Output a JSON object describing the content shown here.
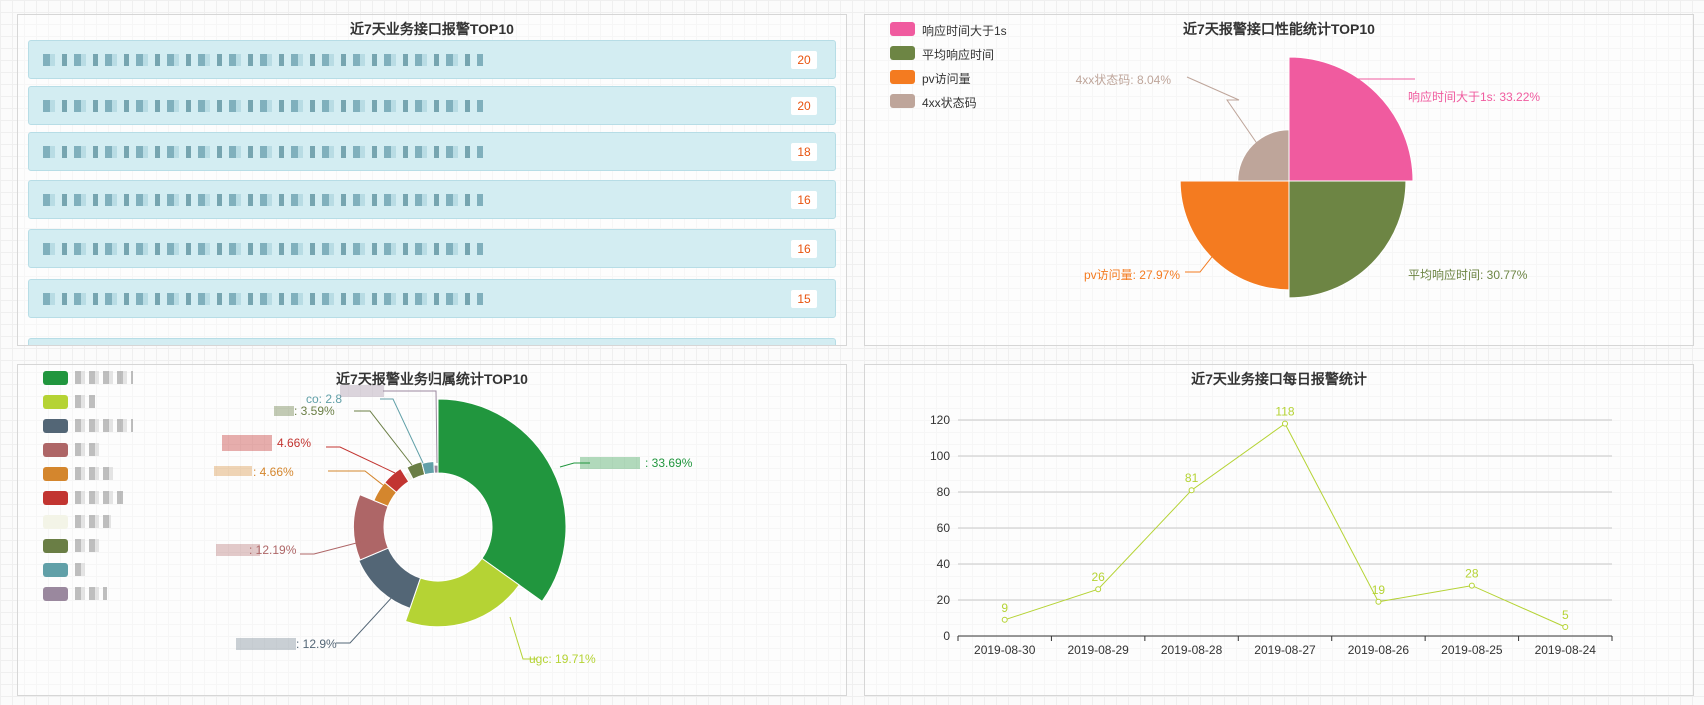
{
  "colors": {
    "pink": "#f05b9f",
    "olive": "#6d8544",
    "orange": "#f47b20",
    "taupe": "#bea59a",
    "green": "#21963e",
    "lime": "#b5d334",
    "slate": "#536676",
    "rose": "#ae6667",
    "amber": "#d4862d",
    "red": "#c23531",
    "ivory": "#f3f4e7",
    "moss": "#6a7e45",
    "teal": "#61a0a8",
    "mauve": "#9a889e",
    "accent_count": "#e8530e",
    "row_bg": "#d3edf2"
  },
  "panel_top10": {
    "title": "近7天业务接口报警TOP10",
    "rows": [
      {
        "count": "20"
      },
      {
        "count": "20"
      },
      {
        "count": "18"
      },
      {
        "count": "16"
      },
      {
        "count": "16"
      },
      {
        "count": "15"
      },
      {
        "count": ""
      }
    ]
  },
  "panel_perf": {
    "title": "近7天报警接口性能统计TOP10",
    "legend": [
      "响应时间大于1s",
      "平均响应时间",
      "pv访问量",
      "4xx状态码"
    ],
    "labels": [
      "响应时间大于1s: 33.22%",
      "平均响应时间: 30.77%",
      "pv访问量: 27.97%",
      "4xx状态码: 8.04%"
    ]
  },
  "panel_owner": {
    "title": "近7天报警业务归属统计TOP10",
    "labels": [
      ": 33.69%",
      "ugc: 19.71%",
      ": 12.9%",
      ": 12.19%",
      ": 4.66%",
      "4.66%",
      ": 3.59%",
      "co: 2.8"
    ]
  },
  "panel_daily": {
    "title": "近7天业务接口每日报警统计"
  },
  "chart_data": [
    {
      "type": "pie",
      "title": "近7天报警接口性能统计TOP10",
      "rose": true,
      "categories": [
        "响应时间大于1s",
        "平均响应时间",
        "pv访问量",
        "4xx状态码"
      ],
      "values": [
        33.22,
        30.77,
        27.97,
        8.04
      ],
      "unit": "%",
      "legend": "top-left"
    },
    {
      "type": "pie",
      "title": "近7天报警业务归属统计TOP10",
      "donut": true,
      "categories": [
        "",
        "ugc",
        "",
        "",
        "",
        "",
        "",
        "",
        "co",
        ""
      ],
      "values": [
        33.69,
        19.71,
        12.9,
        12.19,
        4.66,
        4.66,
        1.4,
        3.59,
        2.8,
        1.0
      ],
      "unit": "%",
      "legend": "left"
    },
    {
      "type": "line",
      "title": "近7天业务接口每日报警统计",
      "categories": [
        "2019-08-30",
        "2019-08-29",
        "2019-08-28",
        "2019-08-27",
        "2019-08-26",
        "2019-08-25",
        "2019-08-24"
      ],
      "values": [
        9,
        26,
        81,
        118,
        19,
        28,
        5
      ],
      "ylim": [
        0,
        120
      ],
      "yticks": [
        0,
        20,
        40,
        60,
        80,
        100,
        120
      ],
      "grid": true
    }
  ]
}
